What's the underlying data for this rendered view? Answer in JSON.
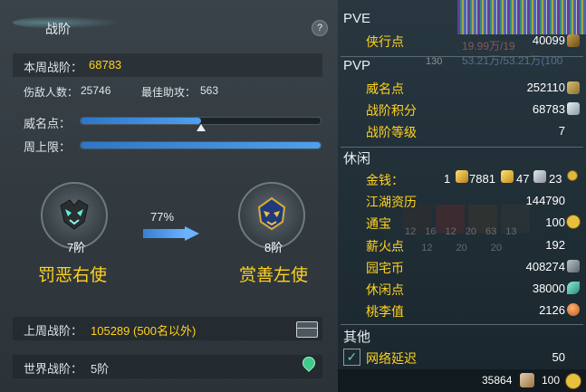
{
  "panel": {
    "title": "战阶",
    "help_label": "?",
    "weekly_label": "本周战阶：",
    "weekly_value": "68783",
    "wound_label": "伤敌人数：",
    "wound_value": "25746",
    "assist_label": "最佳助攻：",
    "assist_value": "563",
    "fame_label": "威名点：",
    "fame_fill": 0.5,
    "weekly_cap_label": "周上限：",
    "weekly_cap_fill": 1.0,
    "left_rank": {
      "level": "7阶",
      "name": "罚恶右使"
    },
    "right_rank": {
      "level": "8阶",
      "name": "赏善左使"
    },
    "progress_pct": "77%",
    "last_week_label": "上周战阶：",
    "last_week_value": "105289 (500名以外)",
    "world_label": "世界战阶：",
    "world_value": "5阶"
  },
  "stats": {
    "pve_header": "PVE",
    "pve_rows": [
      {
        "label": "侠行点",
        "value": "40099",
        "icon": "sword-icon"
      }
    ],
    "pvp_header": "PVP",
    "pvp_rows": [
      {
        "label": "威名点",
        "value": "252110",
        "icon": "banner-icon"
      },
      {
        "label": "战阶积分",
        "value": "68783",
        "icon": "crest-icon"
      },
      {
        "label": "战阶等级",
        "value": "7",
        "icon": ""
      }
    ],
    "leisure_header": "休闲",
    "money_label": "金钱：",
    "money_gold": "1",
    "money_silver": "7881",
    "money_copper": "47",
    "money_extra": "23",
    "leisure_rows": [
      {
        "label": "江湖资历",
        "value": "144790",
        "icon": ""
      },
      {
        "label": "通宝",
        "value": "100",
        "icon": "coin-icon"
      },
      {
        "label": "薪火点",
        "value": "192",
        "icon": ""
      },
      {
        "label": "园宅币",
        "value": "408274",
        "icon": "house-coin-icon"
      },
      {
        "label": "休闲点",
        "value": "38000",
        "icon": "leaf-icon"
      },
      {
        "label": "桃李值",
        "value": "2126",
        "icon": "peach-icon"
      }
    ],
    "other_header": "其他",
    "network_label": "网络延迟",
    "network_value": "50"
  },
  "footer": {
    "vouchers": "35864",
    "coins": "100"
  },
  "background_fragments": {
    "hp_text": "19.99万/19",
    "mp_text": "53.21万/53.21万(100",
    "level_badge": "130",
    "slot_counts": [
      "12",
      "16",
      "12",
      "20",
      "63",
      "13"
    ],
    "slot_counts_low": [
      "12",
      "12",
      "20",
      "20"
    ]
  },
  "colors": {
    "gold_text": "#ffd21f",
    "slider_blue": "#3b8ce0"
  }
}
